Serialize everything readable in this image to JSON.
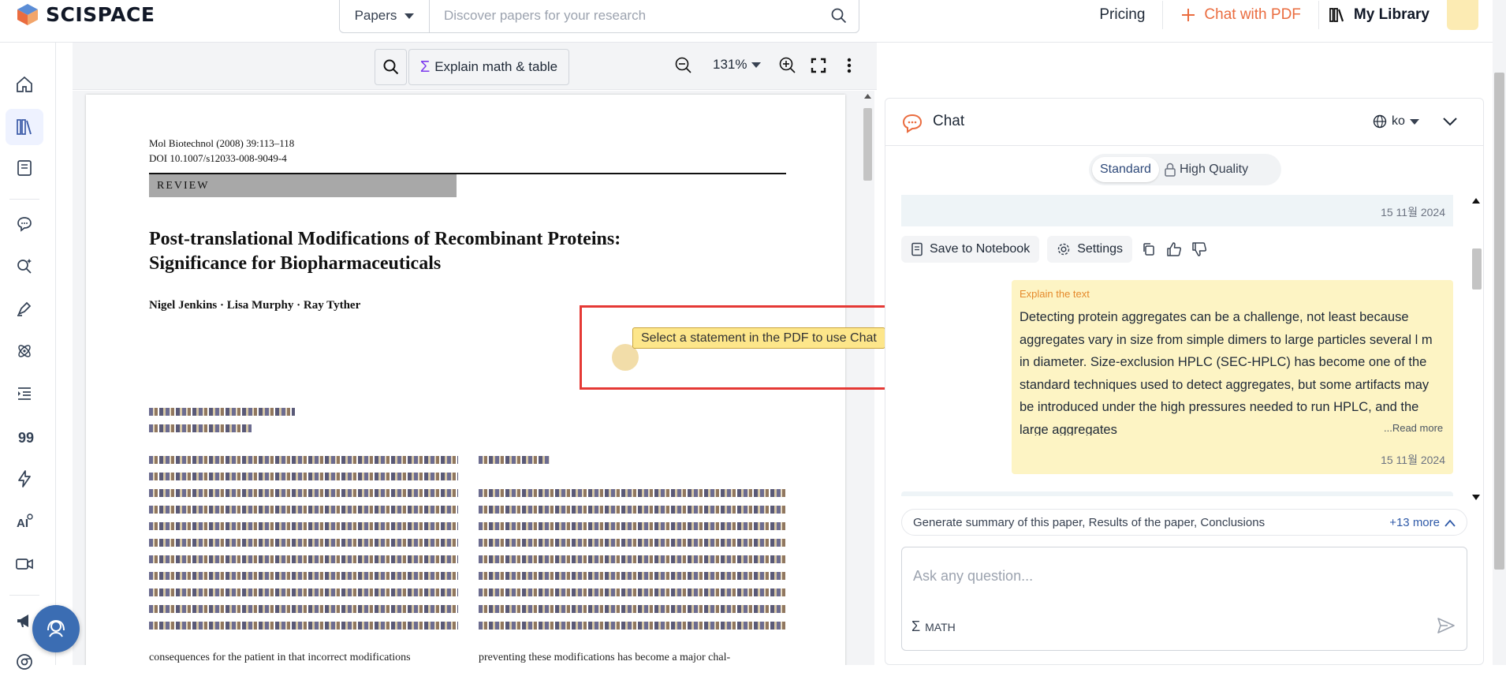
{
  "header": {
    "logo_text": "SCISPACE",
    "search_type": "Papers",
    "search_placeholder": "Discover papers for your research",
    "pricing": "Pricing",
    "chat_with_pdf": "Chat with PDF",
    "my_library": "My Library",
    "accent": "#ea6c3f"
  },
  "rail": {
    "items": [
      "home-icon",
      "library-icon",
      "notebook-icon",
      "chat-icon",
      "search-spark-icon",
      "pen-icon",
      "atom-icon",
      "list-indent-icon",
      "quote-icon",
      "lightning-icon",
      "ai-icon",
      "video-icon",
      "megaphone-icon",
      "chrome-icon"
    ]
  },
  "pdf_toolbar": {
    "explain_label": "Explain math & table",
    "zoom": "131%"
  },
  "pdf": {
    "journal_line1": "Mol Biotechnol (2008) 39:113–118",
    "journal_line2": "DOI 10.1007/s12033-008-9049-4",
    "section": "REVIEW",
    "title": "Post-translational Modifications of Recombinant Proteins: Significance for Biopharmaceuticals",
    "authors": "Nigel Jenkins · Lisa Murphy · Ray Tyther",
    "left_tail": "consequences for the patient in that incorrect modifications",
    "right_tail": "preventing these modifications has become a major chal-"
  },
  "hint": {
    "text": "Select a statement in the PDF to use Chat",
    "frame_color": "#e53935"
  },
  "chat": {
    "title": "Chat",
    "language": "ko",
    "mode_standard": "Standard",
    "mode_high_quality": "High Quality",
    "top_timestamp": "15 11월 2024",
    "save_to_notebook": "Save to Notebook",
    "settings": "Settings",
    "user_message": {
      "label": "Explain the text",
      "body": "Detecting protein aggregates can be a challenge, not least because aggregates vary in size from simple dimers to large particles several l m in diameter. Size-exclusion HPLC (SEC-HPLC) has become one of the standard techniques used to detect aggregates, but some artifacts may be introduced under the high pressures needed to run HPLC, and the large aggregates",
      "read_more": "...Read more",
      "timestamp": "15 11월 2024"
    },
    "suggestions": "Generate summary of this paper, Results of the paper, Conclusions of the paper",
    "more_count": "+13 more",
    "ask_placeholder": "Ask any question...",
    "math_label": "MATH"
  }
}
